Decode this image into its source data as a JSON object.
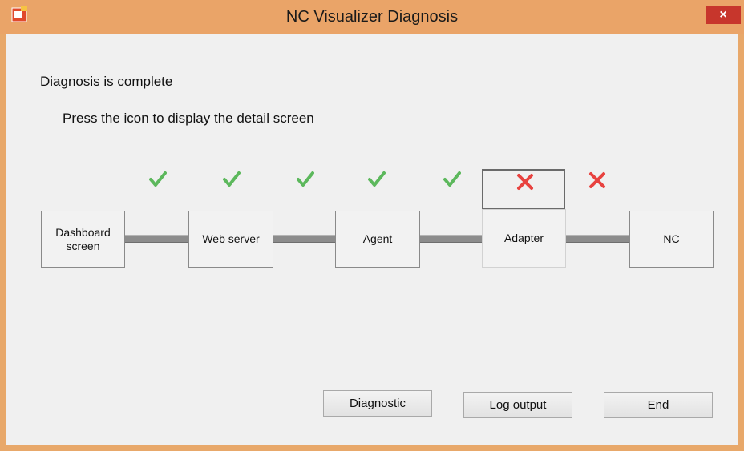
{
  "window": {
    "title": "NC Visualizer Diagnosis",
    "close_label": "×"
  },
  "status_text": "Diagnosis is complete",
  "instruction_text": "Press the icon to display the detail screen",
  "nodes": [
    {
      "label": "Dashboard\nscreen"
    },
    {
      "label": "Web server"
    },
    {
      "label": "Agent"
    },
    {
      "label": "Adapter"
    },
    {
      "label": "NC"
    }
  ],
  "links": [
    {
      "status": "ok",
      "icon": "check-icon"
    },
    {
      "status": "ok",
      "icon": "check-icon"
    },
    {
      "status": "ok",
      "icon": "check-icon"
    },
    {
      "status": "ok",
      "icon": "check-icon"
    },
    {
      "status": "ok",
      "icon": "check-icon"
    },
    {
      "status": "error",
      "icon": "cross-icon"
    },
    {
      "status": "error",
      "icon": "cross-icon"
    }
  ],
  "buttons": {
    "diagnostic": "Diagnostic",
    "log_output": "Log output",
    "end": "End"
  },
  "colors": {
    "ok": "#5cb85c",
    "error": "#e8423f",
    "titlebar": "#eaa468",
    "close": "#c7362c"
  }
}
